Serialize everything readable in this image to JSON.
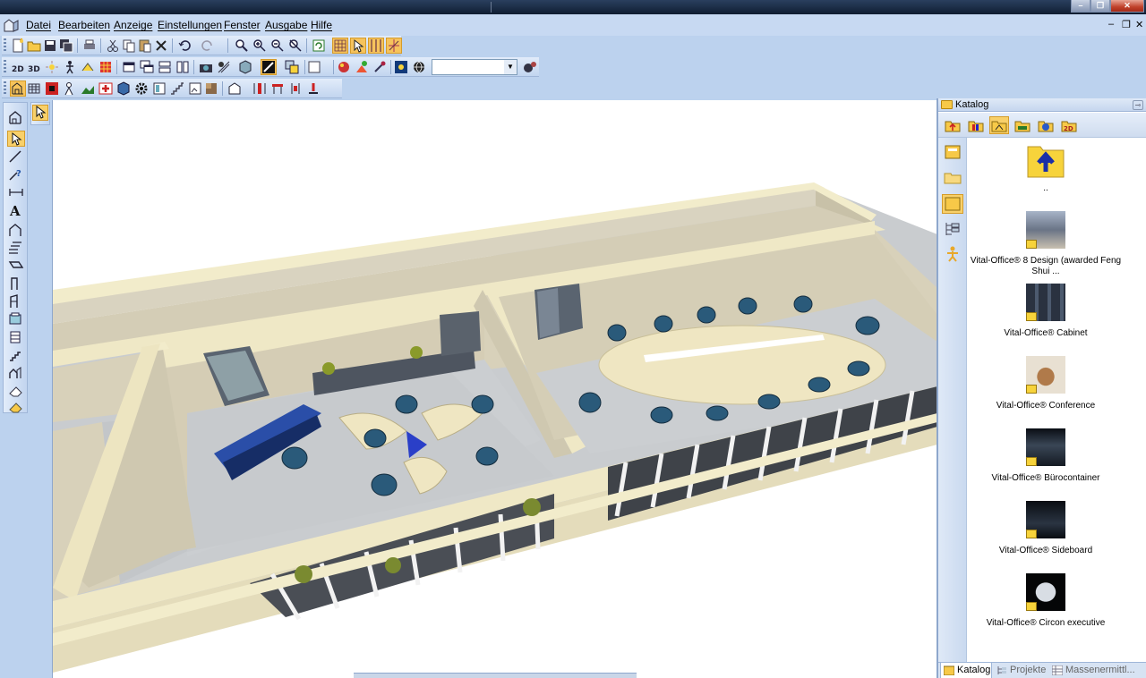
{
  "menu": {
    "items": [
      "Datei",
      "Bearbeiten",
      "Anzeige",
      "Einstellungen",
      "Fenster",
      "Ausgabe",
      "Hilfe"
    ]
  },
  "toolbar": {
    "view_combo_value": ""
  },
  "catalog": {
    "title": "Katalog",
    "up_label": "..",
    "items": [
      "Vital-Office® 8 Design (awarded Feng Shui ...",
      "Vital-Office® Cabinet",
      "Vital-Office®  Conference",
      "Vital-Office® Bürocontainer",
      "Vital-Office®  Sideboard",
      "Vital-Office® Circon executive"
    ],
    "tabs": [
      "Katalog",
      "Projekte",
      "Massenermittl..."
    ]
  },
  "colors": {
    "titlebar": "#1a2b44",
    "menubar": "#c7d9f2",
    "toolbar": "#d2e0f4",
    "wall_cap": "#f2eccb",
    "floor": "#cfd1d3",
    "chair": "#2a5a7a",
    "desk": "#efe6c2",
    "accent": "#f8d06a"
  }
}
